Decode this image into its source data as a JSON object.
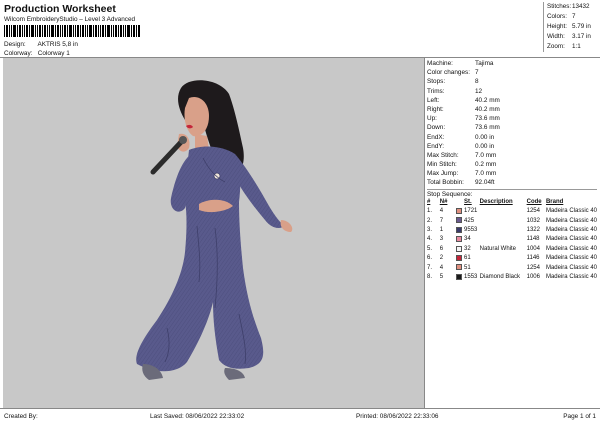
{
  "header": {
    "title": "Production Worksheet",
    "subtitle": "Wilcom EmbroideryStudio – Level 3 Advanced",
    "design_label": "Design:",
    "design_value": "AKTRIS 5,8 in",
    "colorway_label": "Colorway:",
    "colorway_value": "Colorway 1"
  },
  "stats": [
    {
      "label": "Stitches:",
      "value": "13432"
    },
    {
      "label": "Colors:",
      "value": "7"
    },
    {
      "label": "Height:",
      "value": "5.79 in"
    },
    {
      "label": "Width:",
      "value": "3.17 in"
    },
    {
      "label": "Zoom:",
      "value": "1:1"
    }
  ],
  "machine_info": [
    {
      "label": "Machine:",
      "value": "Tajima"
    },
    {
      "label": "Color changes:",
      "value": "7"
    },
    {
      "label": "Stops:",
      "value": "8"
    },
    {
      "label": "Trims:",
      "value": "12"
    },
    {
      "label": "Left:",
      "value": "40.2 mm"
    },
    {
      "label": "Right:",
      "value": "40.2 mm"
    },
    {
      "label": "Up:",
      "value": "73.6 mm"
    },
    {
      "label": "Down:",
      "value": "73.6 mm"
    },
    {
      "label": "EndX:",
      "value": "0.00 in"
    },
    {
      "label": "EndY:",
      "value": "0.00 in"
    },
    {
      "label": "Max Stitch:",
      "value": "7.0 mm"
    },
    {
      "label": "Min Stitch:",
      "value": "0.2 mm"
    },
    {
      "label": "Max Jump:",
      "value": "7.0 mm"
    },
    {
      "label": "Total Bobbin:",
      "value": "92.04ft"
    }
  ],
  "stop_sequence": {
    "title": "Stop Sequence:",
    "columns": [
      "#",
      "N#",
      "St.",
      "Description",
      "Code",
      "Brand"
    ],
    "rows": [
      {
        "idx": "1.",
        "n": "4",
        "color": "#e09080",
        "st": "1721",
        "desc": "",
        "code": "1254",
        "brand": "Madeira Classic 40"
      },
      {
        "idx": "2.",
        "n": "7",
        "color": "#6a5a8e",
        "st": "425",
        "desc": "",
        "code": "1032",
        "brand": "Madeira Classic 40"
      },
      {
        "idx": "3.",
        "n": "1",
        "color": "#3a3a6a",
        "st": "9553",
        "desc": "",
        "code": "1322",
        "brand": "Madeira Classic 40"
      },
      {
        "idx": "4.",
        "n": "3",
        "color": "#e88aa0",
        "st": "34",
        "desc": "",
        "code": "1148",
        "brand": "Madeira Classic 40"
      },
      {
        "idx": "5.",
        "n": "6",
        "color": "#f5f5f5",
        "st": "32",
        "desc": "Natural White",
        "code": "1004",
        "brand": "Madeira Classic 40"
      },
      {
        "idx": "6.",
        "n": "2",
        "color": "#c4263a",
        "st": "61",
        "desc": "",
        "code": "1146",
        "brand": "Madeira Classic 40"
      },
      {
        "idx": "7.",
        "n": "4",
        "color": "#e09080",
        "st": "51",
        "desc": "",
        "code": "1254",
        "brand": "Madeira Classic 40"
      },
      {
        "idx": "8.",
        "n": "5",
        "color": "#1a1a1a",
        "st": "1553",
        "desc": "Diamond Black",
        "code": "1006",
        "brand": "Madeira Classic 40"
      }
    ]
  },
  "footer": {
    "created_by": "Created By:",
    "last_saved": "Last Saved: 08/06/2022 22:33:02",
    "printed": "Printed: 08/06/2022 22:33:06",
    "page": "Page 1 of 1"
  },
  "colors": {
    "canvas_bg": "#c8c8c8",
    "suit": "#595a8c",
    "suit_shadow": "#3e3f6a",
    "hair": "#1e1a1c",
    "skin": "#d9a089",
    "lips": "#c4263a",
    "microphone": "#2b2b2b"
  }
}
